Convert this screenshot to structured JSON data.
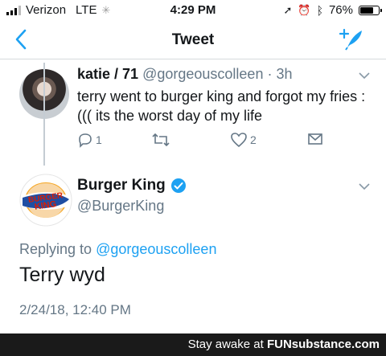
{
  "status_bar": {
    "carrier": "Verizon",
    "network": "LTE",
    "time": "4:29 PM",
    "battery": "76%",
    "battery_level": 0.76
  },
  "nav": {
    "title": "Tweet",
    "back_icon": "chevron-left-icon",
    "compose_icon": "compose-tweet-icon",
    "accent_color": "#1da1f2"
  },
  "parent_tweet": {
    "name": "katie / 71",
    "handle": "@gorgeouscolleen",
    "age": "3h",
    "text": "terry went to burger king and forgot my fries :((( its the worst day of my life",
    "reply_count": "1",
    "like_count": "2"
  },
  "main_tweet": {
    "name": "Burger King",
    "handle": "@BurgerKing",
    "replying_prefix": "Replying to",
    "replying_to": "@gorgeouscolleen",
    "text": "Terry wyd",
    "timestamp": "2/24/18, 12:40 PM"
  },
  "watermark": {
    "prefix": "Stay awake at",
    "brand": "FUNsubstance.com"
  }
}
